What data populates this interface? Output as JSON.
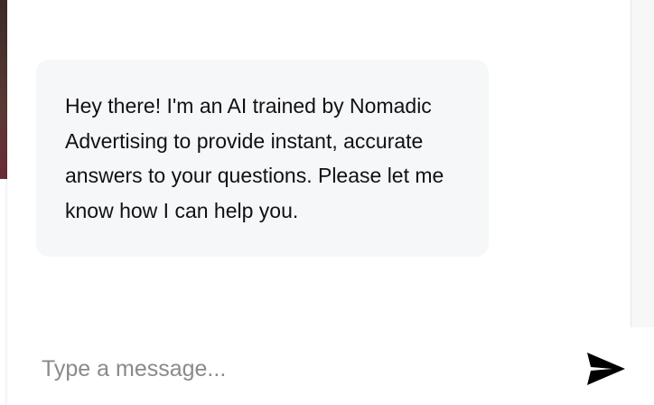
{
  "chat": {
    "messages": [
      {
        "sender": "bot",
        "text": "Hey there! I'm an AI trained by Nomadic Advertising to provide instant, accurate answers to your questions. Please let me know how I can help you."
      }
    ]
  },
  "composer": {
    "placeholder": "Type a message...",
    "value": "",
    "send_icon": "send-icon"
  },
  "colors": {
    "bubble_background": "#f6f7f9",
    "text": "#111111",
    "placeholder": "#8a8a8a"
  }
}
